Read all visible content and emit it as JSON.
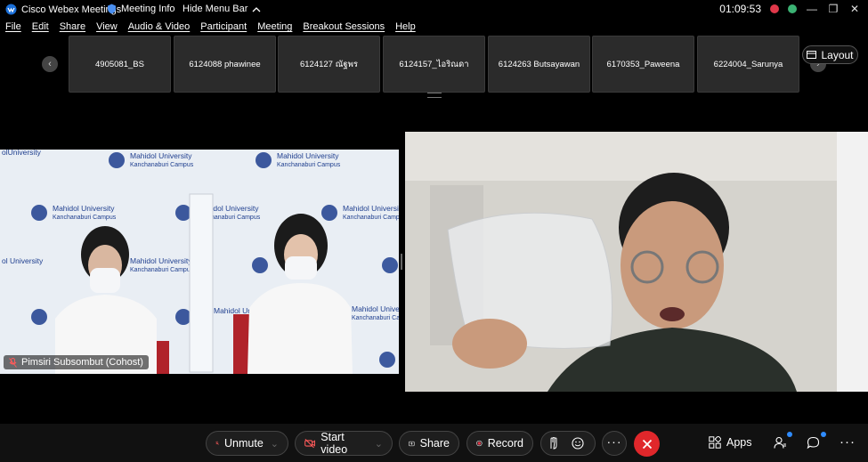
{
  "titlebar": {
    "app_title": "Cisco Webex Meetings",
    "meeting_info": "Meeting Info",
    "hide_menu_bar": "Hide Menu Bar",
    "clock": "01:09:53"
  },
  "menu": [
    "File",
    "Edit",
    "Share",
    "View",
    "Audio & Video",
    "Participant",
    "Meeting",
    "Breakout Sessions",
    "Help"
  ],
  "participants_strip": [
    "4905081_BS",
    "6124088 phawinee",
    "6124127 ณัฐพร",
    "6124157_ไอริณดา",
    "6124263 Butsayawan",
    "6170353_Paweena",
    "6224004_Sarunya"
  ],
  "layout_label": "Layout",
  "video_left": {
    "name": "Pimsiri Subsombut (Cohost)",
    "backdrop_text": [
      "Mahidol University",
      "Kanchanaburi Campus"
    ]
  },
  "toolbar": {
    "unmute": "Unmute",
    "start_video": "Start video",
    "share": "Share",
    "record": "Record",
    "apps": "Apps"
  },
  "colors": {
    "end_call": "#e0272b",
    "notification": "#2f8cff",
    "background": "#000000"
  }
}
